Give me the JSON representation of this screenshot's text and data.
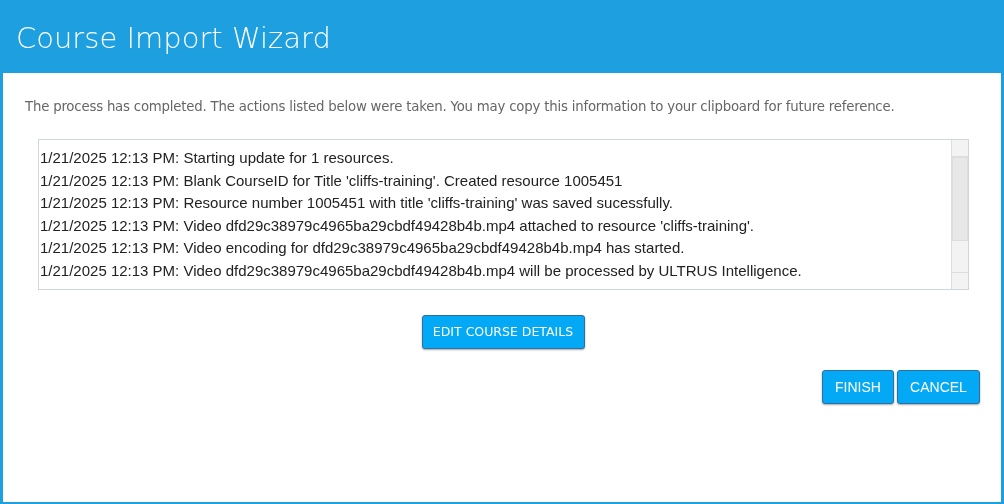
{
  "window": {
    "title": "Course Import Wizard"
  },
  "message": "The process has completed. The actions listed below were taken. You may copy this information to your clipboard for future reference.",
  "log": [
    "1/21/2025 12:13 PM: Starting update for 1 resources.",
    "1/21/2025 12:13 PM: Blank CourseID for Title 'cliffs-training'. Created resource 1005451",
    "1/21/2025 12:13 PM: Resource number 1005451 with title 'cliffs-training' was saved sucessfully.",
    "1/21/2025 12:13 PM: Video dfd29c38979c4965ba29cbdf49428b4b.mp4 attached to resource 'cliffs-training'.",
    "1/21/2025 12:13 PM: Video encoding for dfd29c38979c4965ba29cbdf49428b4b.mp4 has started.",
    "1/21/2025 12:13 PM: Video dfd29c38979c4965ba29cbdf49428b4b.mp4 will be processed by ULTRUS Intelligence."
  ],
  "edit_button": "EDIT COURSE DETAILS",
  "buttons": [
    "FINISH",
    "CANCEL"
  ]
}
